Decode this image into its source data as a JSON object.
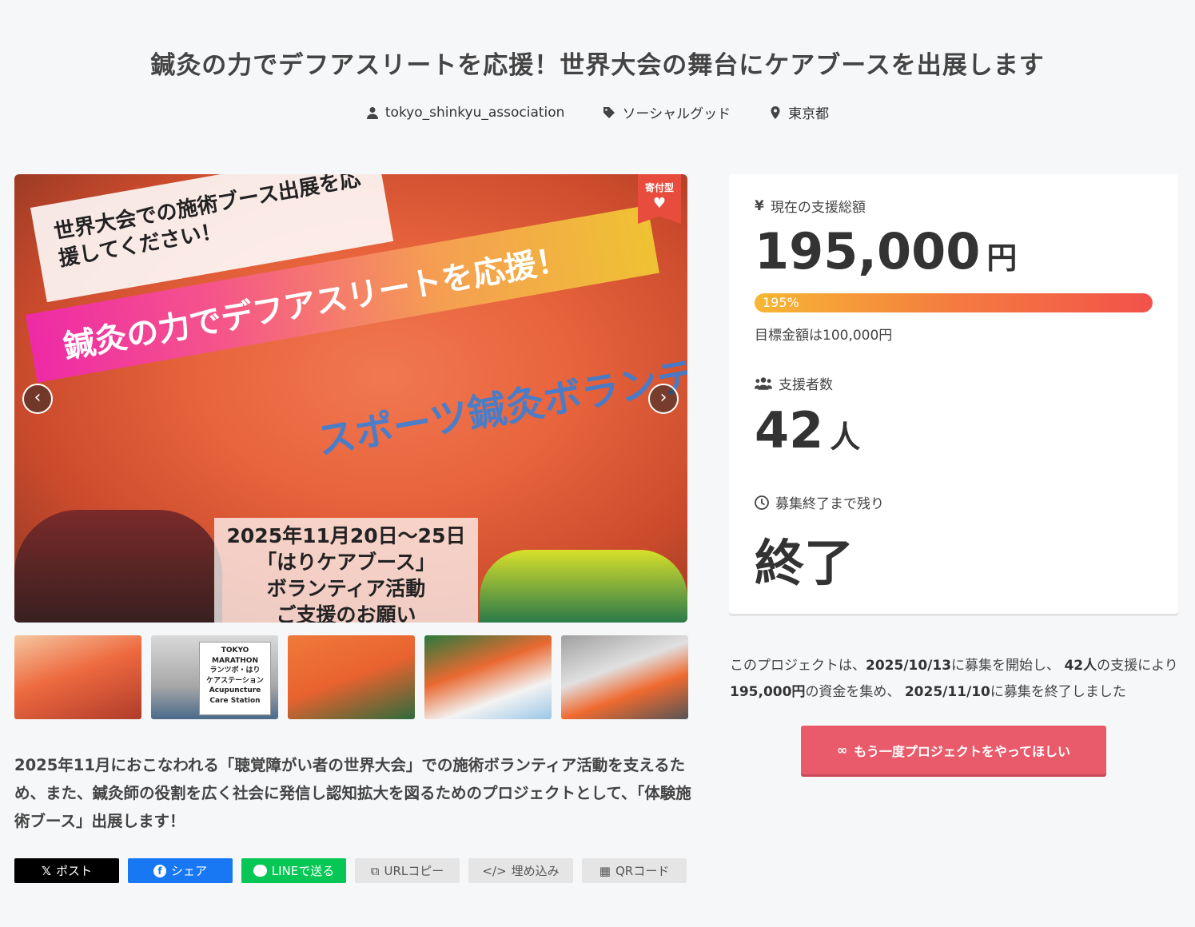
{
  "project": {
    "title": "鍼灸の力でデフアスリートを応援！世界大会の舞台にケアブースを出展します",
    "owner": "tokyo_shinkyu_association",
    "category": "ソーシャルグッド",
    "location": "東京都"
  },
  "hero": {
    "badge": "寄付型",
    "banner_top": "世界大会での施術ブース出展を応援してください！",
    "banner_main": "鍼灸の力でデフアスリートを応援！",
    "jacket_text": "スポーツ鍼灸ボランティア隊",
    "date_lines": [
      "2025年11月20日～25日",
      "「はりケアブース」",
      "ボランティア活動",
      "ご支援のお願い"
    ],
    "thumb2_sign": [
      "TOKYO MARATHON",
      "ランツボ・はり",
      "ケアステーション",
      "Acupuncture Care Station"
    ]
  },
  "description": "2025年11月におこなわれる「聴覚障がい者の世界大会」での施術ボランティア活動を支えるため、また、鍼灸師の役割を広く社会に発信し認知拡大を図るためのプロジェクトとして、「体験施術ブース」出展します！",
  "share": {
    "x": "ポスト",
    "facebook": "シェア",
    "line": "LINEで送る",
    "url": "URLコピー",
    "embed": "埋め込み",
    "qr": "QRコード"
  },
  "stats": {
    "total_label": "現在の支援総額",
    "total_value": "195,000",
    "total_unit": "円",
    "progress_text": "195%",
    "progress_fraction": 1.0,
    "goal_text": "目標金額は100,000円",
    "backers_label": "支援者数",
    "backers_value": "42",
    "backers_unit": "人",
    "remaining_label": "募集終了まで残り",
    "remaining_value": "終了"
  },
  "summary": {
    "prefix": "このプロジェクトは、",
    "start_date": "2025/10/13",
    "mid1": "に募集を開始し、",
    "backers": "42人",
    "mid2": "の支援により",
    "amount": "195,000円",
    "mid3": "の資金を集め、",
    "end_date": "2025/11/10",
    "suffix": "に募集を終了しました"
  },
  "again_button": "もう一度プロジェクトをやってほしい",
  "colors": {
    "accent": "#e95b6b",
    "badge": "#e74c3c",
    "line": "#06c755",
    "facebook": "#1877f2"
  }
}
